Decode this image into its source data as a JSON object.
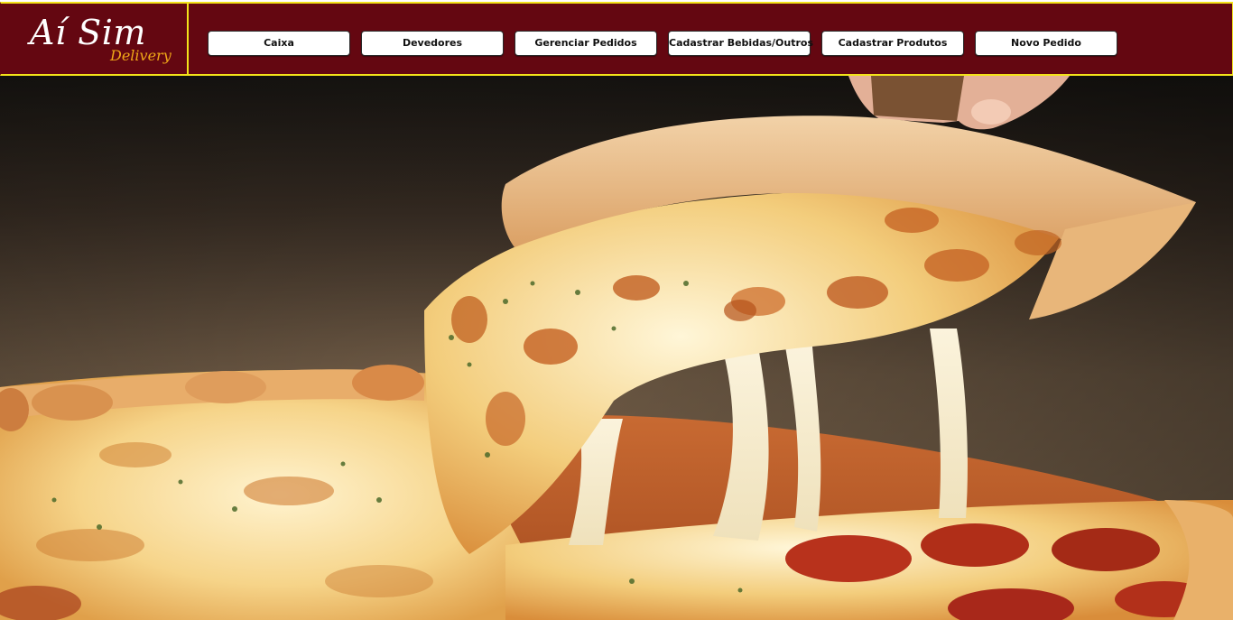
{
  "brand": {
    "name": "Aí Sim",
    "tagline": "Delivery"
  },
  "nav": {
    "items": [
      {
        "label": "Caixa"
      },
      {
        "label": "Devedores"
      },
      {
        "label": "Gerenciar Pedidos"
      },
      {
        "label": "Cadastrar Bebidas/Outros"
      },
      {
        "label": "Cadastrar Produtos"
      },
      {
        "label": "Novo Pedido"
      }
    ]
  },
  "hero": {
    "image": "pizza-slice-cheese-pull-photo"
  },
  "colors": {
    "header_bg": "#640711",
    "header_border": "#f3e31a",
    "tagline": "#f0a818",
    "button_bg": "#ffffff"
  }
}
